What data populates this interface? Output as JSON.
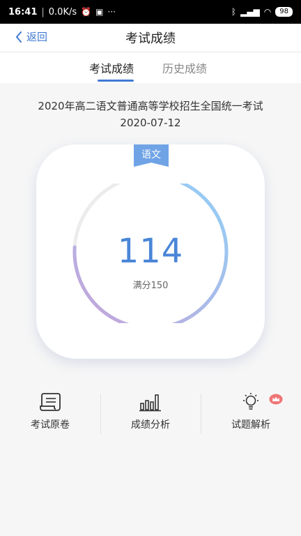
{
  "statusbar": {
    "time": "16:41",
    "speed": "0.0K/s",
    "battery": "98"
  },
  "nav": {
    "back_label": "返回",
    "title": "考试成绩"
  },
  "tabs": [
    {
      "label": "考试成绩",
      "active": true
    },
    {
      "label": "历史成绩",
      "active": false
    }
  ],
  "exam": {
    "name": "2020年高二语文普通高等学校招生全国统一考试",
    "date": "2020-07-12"
  },
  "score_card": {
    "subject": "语文",
    "score": "114",
    "full_mark_text": "满分150",
    "score_fraction": 0.76
  },
  "actions": [
    {
      "label": "考试原卷",
      "icon": "scroll-icon"
    },
    {
      "label": "成绩分析",
      "icon": "bar-chart-icon"
    },
    {
      "label": "试题解析",
      "icon": "lightbulb-icon",
      "badge": "crown-icon"
    }
  ],
  "colors": {
    "accent": "#3f7ad3",
    "score": "#4a86d8",
    "ring_start": "#c7a2d8",
    "ring_end": "#8fd1f8",
    "ring_track": "#ececec",
    "crown": "#f07575"
  }
}
